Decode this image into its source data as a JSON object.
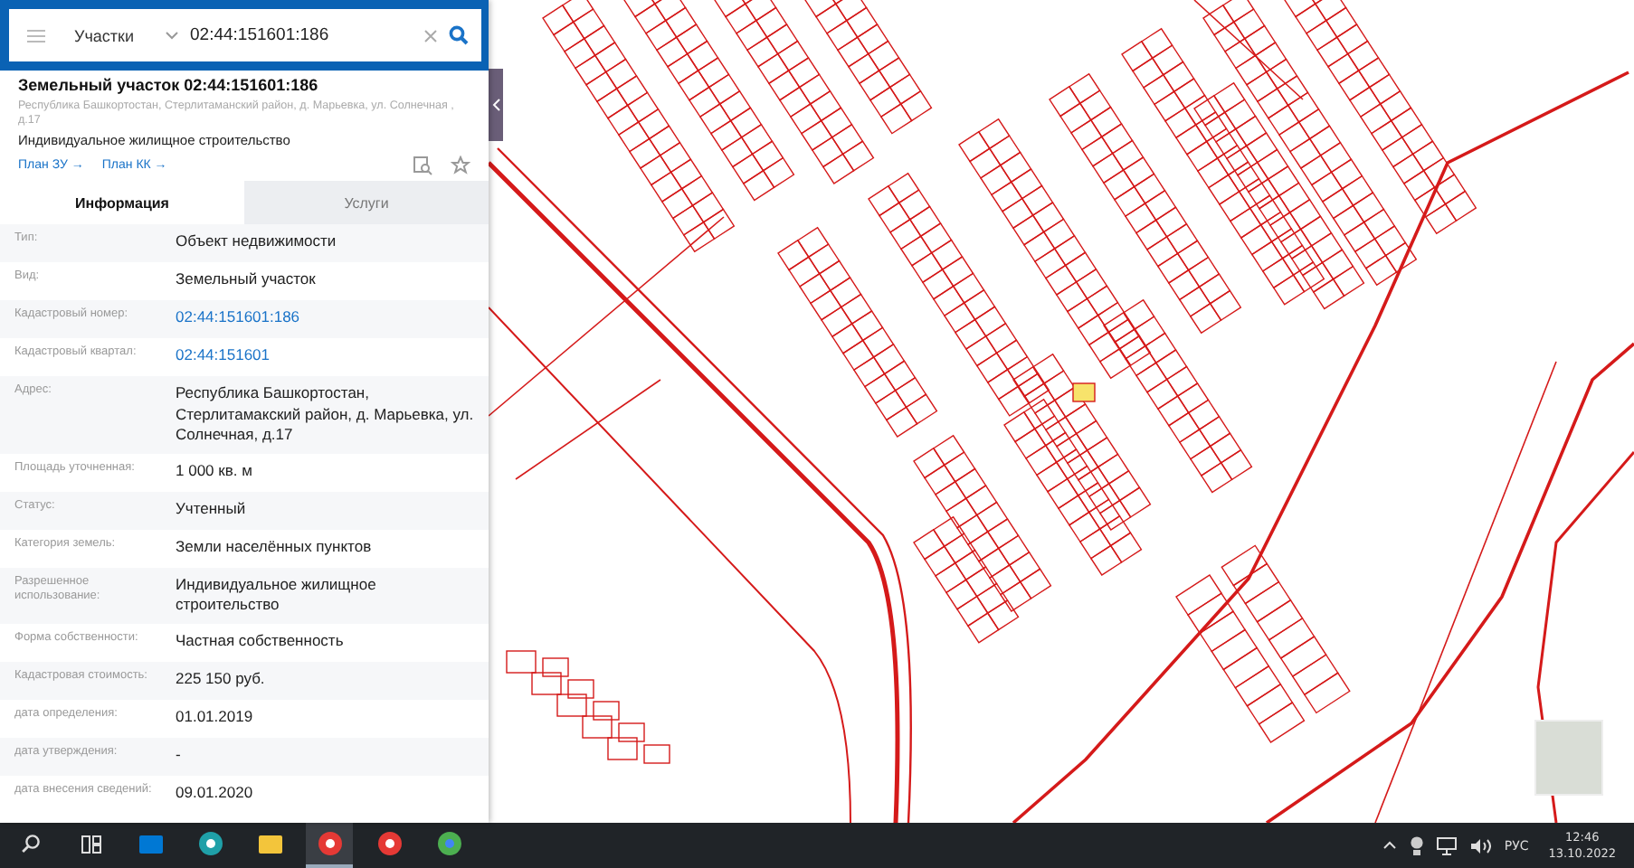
{
  "search": {
    "category": "Участки",
    "value": "02:44:151601:186"
  },
  "card": {
    "title": "Земельный участок 02:44:151601:186",
    "address": "Республика Башкортостан, Стерлитаманский район, д. Марьевка, ул. Солнечная , д.17",
    "purpose": "Индивидуальное жилищное строительство",
    "links": [
      "План ЗУ →",
      "План КК →"
    ]
  },
  "tabs": [
    {
      "label": "Информация",
      "selected": true
    },
    {
      "label": "Услуги",
      "selected": false
    }
  ],
  "rows": [
    {
      "label": "Тип:",
      "value": "Объект недвижимости",
      "kind": "text"
    },
    {
      "label": "Вид:",
      "value": "Земельный участок",
      "kind": "text"
    },
    {
      "label": "Кадастровый номер:",
      "value": "02:44:151601:186",
      "kind": "link"
    },
    {
      "label": "Кадастровый квартал:",
      "value": "02:44:151601",
      "kind": "link"
    },
    {
      "label": "Адрес:",
      "value": "Республика Башкортостан, Стерлитамакский район, д. Марьевка, ул. Солнечная, д.17",
      "kind": "text"
    },
    {
      "label": "Площадь уточненная:",
      "value": "1 000 кв. м",
      "kind": "text"
    },
    {
      "label": "Статус:",
      "value": "Учтенный",
      "kind": "text"
    },
    {
      "label": "Категория земель:",
      "value": "Земли населённых пунктов",
      "kind": "text"
    },
    {
      "label": "Разрешенное использование:",
      "value": "Индивидуальное жилищное строительство",
      "kind": "text"
    },
    {
      "label": "Форма собственности:",
      "value": "Частная собственность",
      "kind": "text"
    },
    {
      "label": "Кадастровая стоимость:",
      "value": "225 150 руб.",
      "kind": "text"
    },
    {
      "label": "дата определения:",
      "value": "01.01.2019",
      "kind": "text"
    },
    {
      "label": "дата утверждения:",
      "value": "-",
      "kind": "text"
    },
    {
      "label": "дата внесения сведений:",
      "value": "09.01.2020",
      "kind": "text"
    }
  ],
  "taskbar": {
    "apps": [
      {
        "kind": "search",
        "selected": false
      },
      {
        "kind": "taskview",
        "selected": false
      },
      {
        "kind": "store",
        "selected": false
      },
      {
        "kind": "edge",
        "selected": false
      },
      {
        "kind": "explorer",
        "selected": false
      },
      {
        "kind": "ybrowser",
        "selected": true
      },
      {
        "kind": "yandex",
        "selected": false
      },
      {
        "kind": "chrome",
        "selected": false
      }
    ],
    "language": "РУС",
    "time": "12:46",
    "date": "13.10.2022"
  }
}
